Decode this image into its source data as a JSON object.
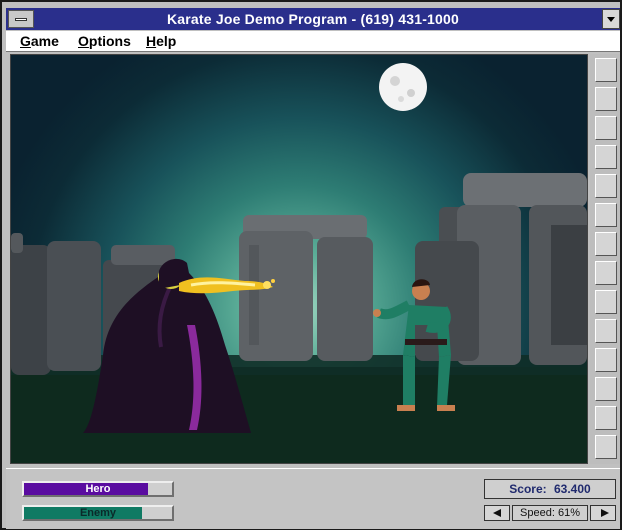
{
  "window": {
    "title": "Karate Joe Demo Program - (619) 431-1000"
  },
  "menu": {
    "game": "Game",
    "options": "Options",
    "help": "Help"
  },
  "status": {
    "hero": {
      "label": "Hero",
      "health": 0.84,
      "color": "#5a0ca0",
      "text_color": "#ffffff"
    },
    "enemy": {
      "label": "Enemy",
      "health": 0.8,
      "color": "#0f7a63",
      "text_color": "#0a2a2a"
    },
    "score": {
      "label": "Score:",
      "value": "63.400"
    },
    "speed": {
      "label": "Speed:",
      "value": "61%"
    }
  },
  "colors": {
    "title_bar": "#2a2f8c",
    "sky_glow": "#9fd6c1",
    "stone": "#5a5e62",
    "wizard_robe": "#1e0f24",
    "wizard_lining": "#8a2a9c",
    "fire_blast": "#f0c020",
    "karateka_gi": "#1f7e64"
  },
  "scene": {
    "location": "stonehenge-night"
  }
}
